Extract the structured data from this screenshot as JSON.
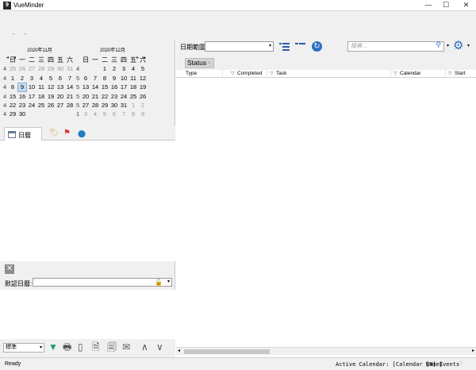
{
  "window": {
    "app_icon_label": "9",
    "title": "VueMinder",
    "minimize": "—",
    "maximize": "☐",
    "close": "✕"
  },
  "toolbar": {
    "small_a": "-",
    "small_b": "-"
  },
  "calendars": [
    {
      "header": "2020年11月",
      "dow": [
        "日",
        "一",
        "二",
        "三",
        "四",
        "五",
        "六"
      ],
      "weeks": [
        {
          "wk": "4",
          "days": [
            {
              "d": "25",
              "dim": true
            },
            {
              "d": "26",
              "dim": true
            },
            {
              "d": "27",
              "dim": true
            },
            {
              "d": "28",
              "dim": true
            },
            {
              "d": "29",
              "dim": true
            },
            {
              "d": "30",
              "dim": true
            },
            {
              "d": "31",
              "dim": true
            }
          ]
        },
        {
          "wk": "4",
          "days": [
            {
              "d": "1"
            },
            {
              "d": "2"
            },
            {
              "d": "3"
            },
            {
              "d": "4"
            },
            {
              "d": "5"
            },
            {
              "d": "6"
            },
            {
              "d": "7"
            }
          ]
        },
        {
          "wk": "4",
          "days": [
            {
              "d": "8"
            },
            {
              "d": "9",
              "today": true
            },
            {
              "d": "10"
            },
            {
              "d": "11"
            },
            {
              "d": "12"
            },
            {
              "d": "13"
            },
            {
              "d": "14"
            }
          ]
        },
        {
          "wk": "4",
          "days": [
            {
              "d": "15"
            },
            {
              "d": "16"
            },
            {
              "d": "17"
            },
            {
              "d": "18"
            },
            {
              "d": "19"
            },
            {
              "d": "20"
            },
            {
              "d": "21"
            }
          ]
        },
        {
          "wk": "4",
          "days": [
            {
              "d": "22"
            },
            {
              "d": "23"
            },
            {
              "d": "24"
            },
            {
              "d": "25"
            },
            {
              "d": "26"
            },
            {
              "d": "27"
            },
            {
              "d": "28"
            }
          ]
        },
        {
          "wk": "4",
          "days": [
            {
              "d": "29"
            },
            {
              "d": "30"
            }
          ]
        }
      ]
    },
    {
      "header": "2020年12月",
      "dow": [
        "日",
        "一",
        "二",
        "三",
        "四",
        "五",
        "六"
      ],
      "weeks": [
        {
          "wk": "4",
          "days": [
            {
              "d": ""
            },
            {
              "d": ""
            },
            {
              "d": "1"
            },
            {
              "d": "2"
            },
            {
              "d": "3"
            },
            {
              "d": "4"
            },
            {
              "d": "5"
            }
          ]
        },
        {
          "wk": "5",
          "days": [
            {
              "d": "6"
            },
            {
              "d": "7"
            },
            {
              "d": "8"
            },
            {
              "d": "9"
            },
            {
              "d": "10"
            },
            {
              "d": "11"
            },
            {
              "d": "12"
            }
          ]
        },
        {
          "wk": "5",
          "days": [
            {
              "d": "13"
            },
            {
              "d": "14"
            },
            {
              "d": "15"
            },
            {
              "d": "16"
            },
            {
              "d": "17"
            },
            {
              "d": "18"
            },
            {
              "d": "19"
            }
          ]
        },
        {
          "wk": "5",
          "days": [
            {
              "d": "20"
            },
            {
              "d": "21"
            },
            {
              "d": "22"
            },
            {
              "d": "23"
            },
            {
              "d": "24"
            },
            {
              "d": "25"
            },
            {
              "d": "26"
            }
          ]
        },
        {
          "wk": "5",
          "days": [
            {
              "d": "27"
            },
            {
              "d": "28"
            },
            {
              "d": "29"
            },
            {
              "d": "30"
            },
            {
              "d": "31"
            },
            {
              "d": "1",
              "dim": true
            },
            {
              "d": "2",
              "dim": true
            }
          ]
        },
        {
          "wk": "1",
          "days": [
            {
              "d": "3",
              "dim": true
            },
            {
              "d": "4",
              "dim": true
            },
            {
              "d": "5",
              "dim": true
            },
            {
              "d": "6",
              "dim": true
            },
            {
              "d": "7",
              "dim": true
            },
            {
              "d": "8",
              "dim": true
            },
            {
              "d": "9",
              "dim": true
            }
          ]
        }
      ]
    }
  ],
  "cal_nav": {
    "prev_prev": "◂",
    "prev": "◂",
    "next": "▸",
    "next_next": "▸"
  },
  "left_tabs": {
    "calendar_label": "日曆",
    "tag_icon": "🏷",
    "flag_icon": "⚑",
    "location_icon": "⬤"
  },
  "left_lower": {
    "close_label": "✕",
    "default_calendar_label": "默認日曆:",
    "default_calendar_value": "",
    "lock_icon": "🔓",
    "caret": "▾"
  },
  "bottom_toolbar": {
    "filter_value": "標準",
    "caret": "▾",
    "icons": [
      "▼",
      "🖶",
      "▯",
      "🗎",
      "🗐",
      "✉",
      "∧",
      "∨"
    ]
  },
  "right_toolbar": {
    "date_range_label": "日期範圍:",
    "date_range_value": "",
    "caret": "▾",
    "refresh_icon": "↻",
    "search_placeholder": "搜尋...",
    "search_icon": "⚲",
    "gear_icon": "⚙"
  },
  "group_bar": {
    "status_label": "Status",
    "sort_glyph": "▵"
  },
  "task_columns": [
    {
      "label": "Type"
    },
    {
      "label": "Completed"
    },
    {
      "label": "Task"
    },
    {
      "label": "Calendar"
    },
    {
      "label": "Start"
    }
  ],
  "filter_glyph": "▽",
  "hscroll": {
    "left": "◂",
    "right": "▸"
  },
  "statusbar": {
    "ready": "Ready",
    "active_calendar": "Active Calendar: [Calendar Name]",
    "events": "[N] Events",
    "busy_icon": "◌"
  }
}
